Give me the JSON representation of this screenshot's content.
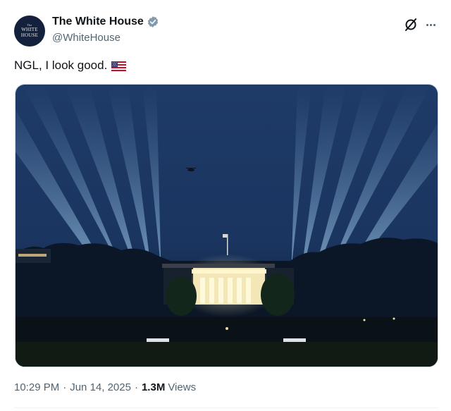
{
  "account": {
    "display_name": "The White House",
    "handle": "@WhiteHouse",
    "avatar_text": [
      "The",
      "WHITE",
      "HOUSE"
    ],
    "verified": true,
    "verified_color": "#829aab"
  },
  "header_actions": {
    "grok_icon": "grok-icon",
    "more_icon": "more-options-icon"
  },
  "tweet": {
    "text": "NGL, I look good.",
    "emoji": "us-flag"
  },
  "media": {
    "description_icon": "photo"
  },
  "meta": {
    "time": "10:29 PM",
    "date": "Jun 14, 2025",
    "separator": "·",
    "views_count": "1.3M",
    "views_label": "Views"
  },
  "colors": {
    "text_primary": "#0f1419",
    "text_secondary": "#536471",
    "border": "#cfd9de"
  }
}
